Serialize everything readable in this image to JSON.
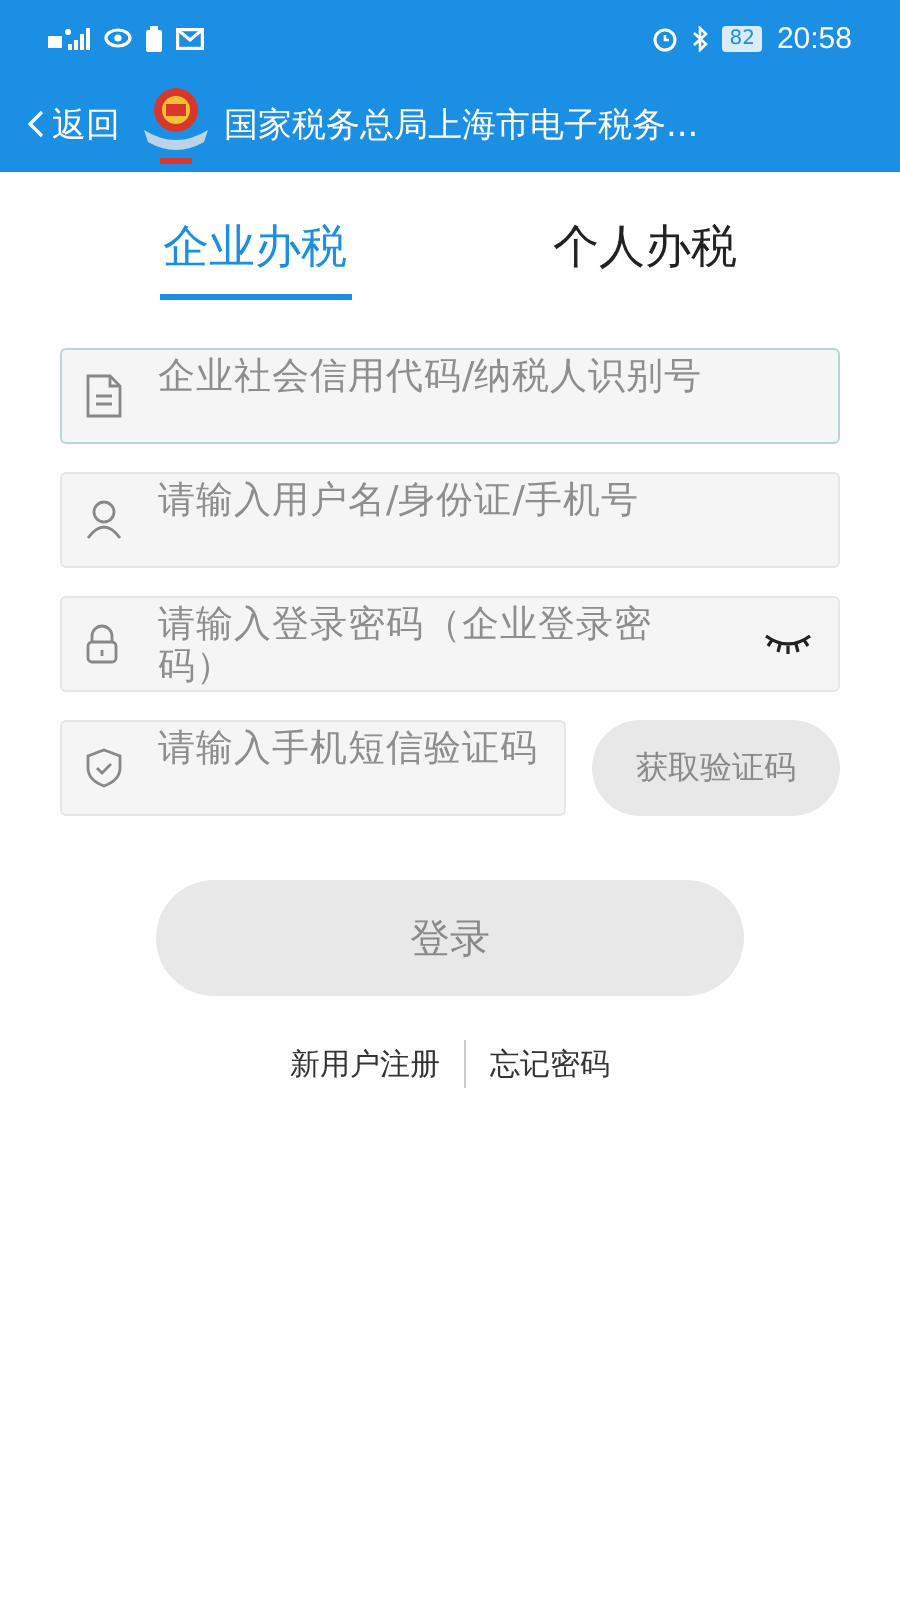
{
  "status_bar": {
    "battery": "82",
    "time": "20:58"
  },
  "header": {
    "back": "返回",
    "title": "国家税务总局上海市电子税务..."
  },
  "tabs": [
    {
      "label": "企业办税",
      "selected": true
    },
    {
      "label": "个人办税",
      "selected": false
    }
  ],
  "fields": [
    {
      "kind": "document",
      "placeholder": "企业社会信用代码/纳税人识别号",
      "focused": true
    },
    {
      "kind": "user",
      "placeholder": "请输入用户名/身份证/手机号",
      "focused": false
    },
    {
      "kind": "password",
      "placeholder": "请输入登录密码（企业登录密码）",
      "focused": false,
      "password_visible": false
    },
    {
      "kind": "code",
      "placeholder": "请输入手机短信验证码",
      "focused": false,
      "button": {
        "label": "获取验证码",
        "disabled": true
      }
    }
  ],
  "login_button": {
    "label": "登录",
    "disabled": true
  },
  "links": [
    "新用户注册",
    "忘记密码"
  ]
}
